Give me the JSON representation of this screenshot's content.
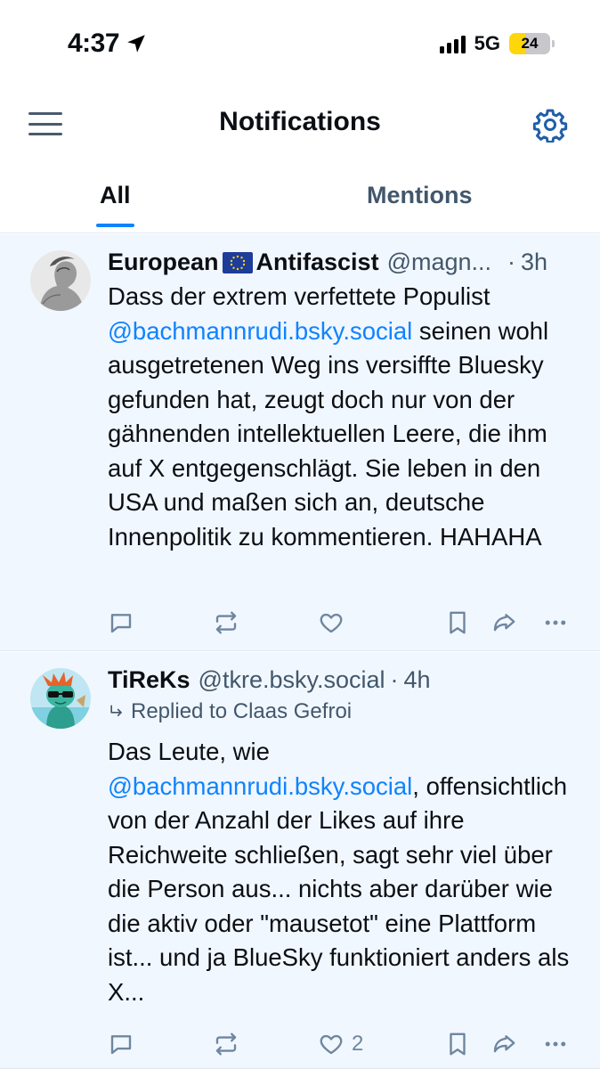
{
  "status_bar": {
    "time": "4:37",
    "network": "5G",
    "battery": "24"
  },
  "header": {
    "title": "Notifications"
  },
  "tabs": [
    {
      "label": "All",
      "active": true
    },
    {
      "label": "Mentions",
      "active": false
    }
  ],
  "notifications": [
    {
      "author_part1": "European",
      "author_part2": "Antifascist",
      "handle": "@magn...",
      "separator": "·",
      "age": "3h",
      "text_before": "Dass der extrem verfettete Populist ",
      "mention": "@bachmannrudi.bsky.social",
      "text_after": " seinen wohl ausgetretenen Weg ins versiffte Bluesky gefunden hat, zeugt doch nur von der gähnenden intellektuellen Leere, die ihm auf X entgegenschlägt. Sie leben in den USA und maßen sich an, deutsche Innenpolitik zu kommentieren. HAHAHA",
      "like_count": ""
    },
    {
      "author": "TiReKs",
      "handle": "@tkre.bsky.social",
      "separator": "·",
      "age": "4h",
      "reply_to": "Replied to Claas Gefroi",
      "text_before": "Das Leute, wie ",
      "mention": "@bachmannrudi.bsky.social",
      "text_after": ", offensichtlich von der Anzahl der Likes auf ihre Reichweite schließen, sagt sehr viel über die Person aus... nichts aber darüber wie die aktiv oder \"mausetot\" eine Plattform ist... und ja BlueSky funktioniert anders als X...",
      "like_count": "2"
    }
  ],
  "colors": {
    "accent": "#1083fe",
    "muted": "#42576c",
    "icon": "#6f869f",
    "unread_bg": "#f1f7fe"
  },
  "icons": [
    "location-arrow-icon",
    "menu-icon",
    "gear-icon",
    "reply-icon",
    "repost-icon",
    "heart-icon",
    "bookmark-icon",
    "share-icon",
    "more-icon",
    "eu-flag-icon"
  ]
}
